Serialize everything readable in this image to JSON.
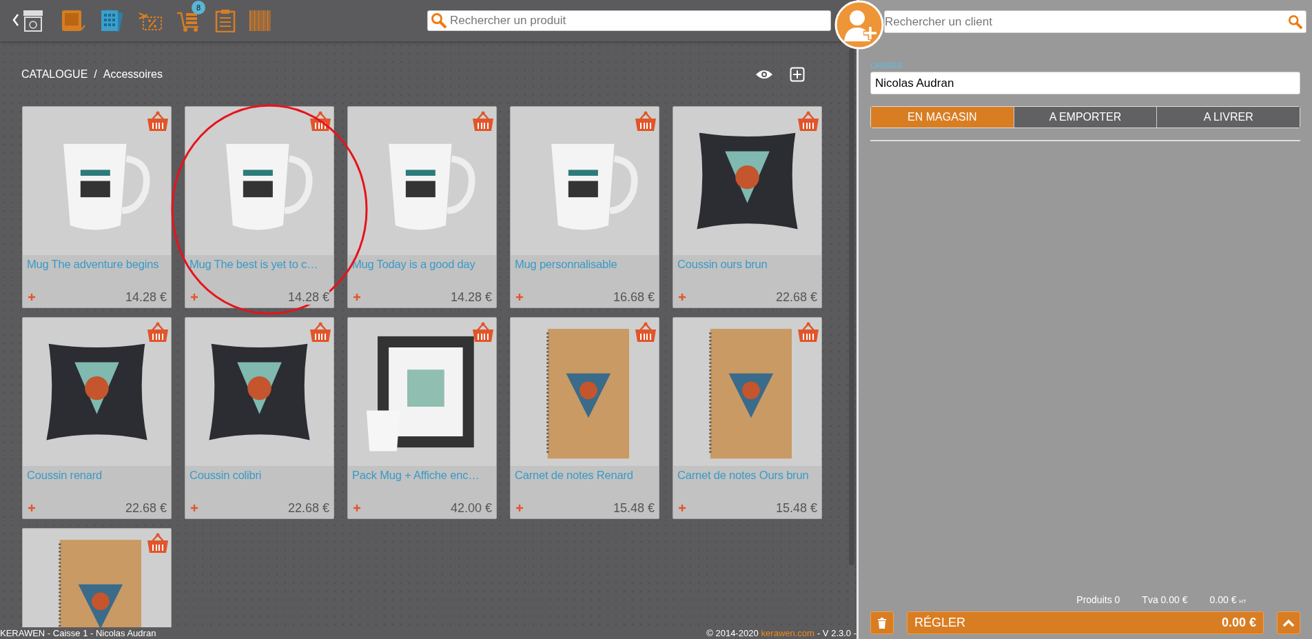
{
  "toolbar": {
    "cart_badge": "8"
  },
  "product_search": {
    "placeholder": "Rechercher un produit"
  },
  "client_search": {
    "placeholder": "Rechercher un client"
  },
  "breadcrumb": {
    "root": "CATALOGUE",
    "separator": "/",
    "current": "Accessoires"
  },
  "products": [
    {
      "kind": "mug",
      "name": "Mug The adventure begins",
      "price": "14.28 €"
    },
    {
      "kind": "mug",
      "name": "Mug The best is yet to c…",
      "price": "14.28 €"
    },
    {
      "kind": "mug",
      "name": "Mug Today is a good day",
      "price": "14.28 €"
    },
    {
      "kind": "mug",
      "name": "Mug personnalisable",
      "price": "16.68 €"
    },
    {
      "kind": "cushion",
      "name": "Coussin ours brun",
      "price": "22.68 €"
    },
    {
      "kind": "cushion",
      "name": "Coussin renard",
      "price": "22.68 €"
    },
    {
      "kind": "cushion",
      "name": "Coussin colibri",
      "price": "22.68 €"
    },
    {
      "kind": "pack",
      "name": "Pack Mug + Affiche enc…",
      "price": "42.00 €"
    },
    {
      "kind": "notebook",
      "name": "Carnet de notes Renard",
      "price": "15.48 €"
    },
    {
      "kind": "notebook",
      "name": "Carnet de notes Ours brun",
      "price": "15.48 €"
    },
    {
      "kind": "notebook"
    }
  ],
  "cashier": {
    "label": "CAISSIER",
    "value": "Nicolas Audran"
  },
  "order_modes": [
    {
      "label": "EN MAGASIN",
      "selected": true
    },
    {
      "label": "A EMPORTER",
      "selected": false
    },
    {
      "label": "A LIVRER",
      "selected": false
    }
  ],
  "summary": {
    "products": "Produits 0",
    "tva": "Tva 0.00 €",
    "total": "0.00 €",
    "total_suffix": "HT"
  },
  "pay_button": {
    "label": "RÉGLER",
    "amount": "0.00 €"
  },
  "footer": {
    "left": "KERAWEN - Caisse 1 - Nicolas Audran",
    "copyright": "© 2014-2020",
    "link": "kerawen.com",
    "version": "- V 2.3.0 -"
  }
}
